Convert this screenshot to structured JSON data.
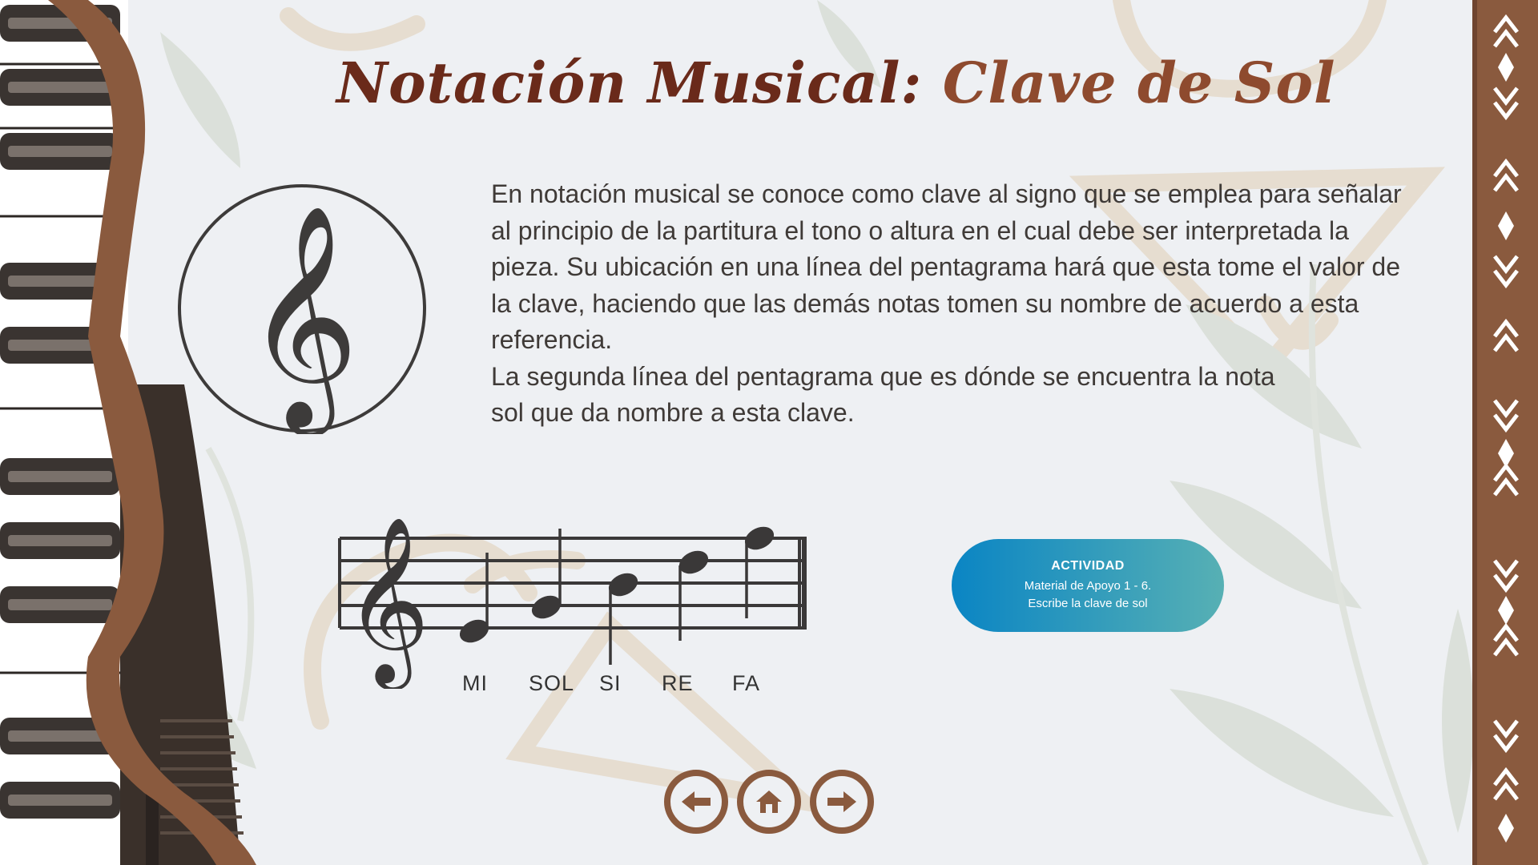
{
  "title": {
    "part1": "Notación Musical:",
    "part2": "Clave de Sol"
  },
  "body": {
    "paragraph1": "En notación musical se conoce como clave al signo que se emplea para señalar al principio de la partitura el tono o altura en el cual debe ser interpretada la pieza. Su ubicación en una línea del pentagrama hará que esta tome el valor de la clave, haciendo que las demás notas tomen su nombre de acuerdo a esta referencia.",
    "paragraph2_line1": "La segunda línea del pentagrama que es dónde se encuentra la nota",
    "paragraph2_line2": "sol que da nombre a esta clave."
  },
  "staff": {
    "labels": [
      "MI",
      "SOL",
      "SI",
      "RE",
      "FA"
    ]
  },
  "activity": {
    "title": "ACTIVIDAD",
    "line1": "Material de Apoyo 1 - 6.",
    "line2": "Escribe la clave de sol"
  },
  "navigation": {
    "prev": "arrow-left-icon",
    "home": "home-icon",
    "next": "arrow-right-icon"
  },
  "colors": {
    "brown": "#8a5a3e",
    "title_dark": "#6a2a1a",
    "title_light": "#8e4a2e",
    "text": "#3f3a37",
    "activity_start": "#0a85c4",
    "activity_end": "#57b0b4",
    "background": "#eef0f3"
  }
}
